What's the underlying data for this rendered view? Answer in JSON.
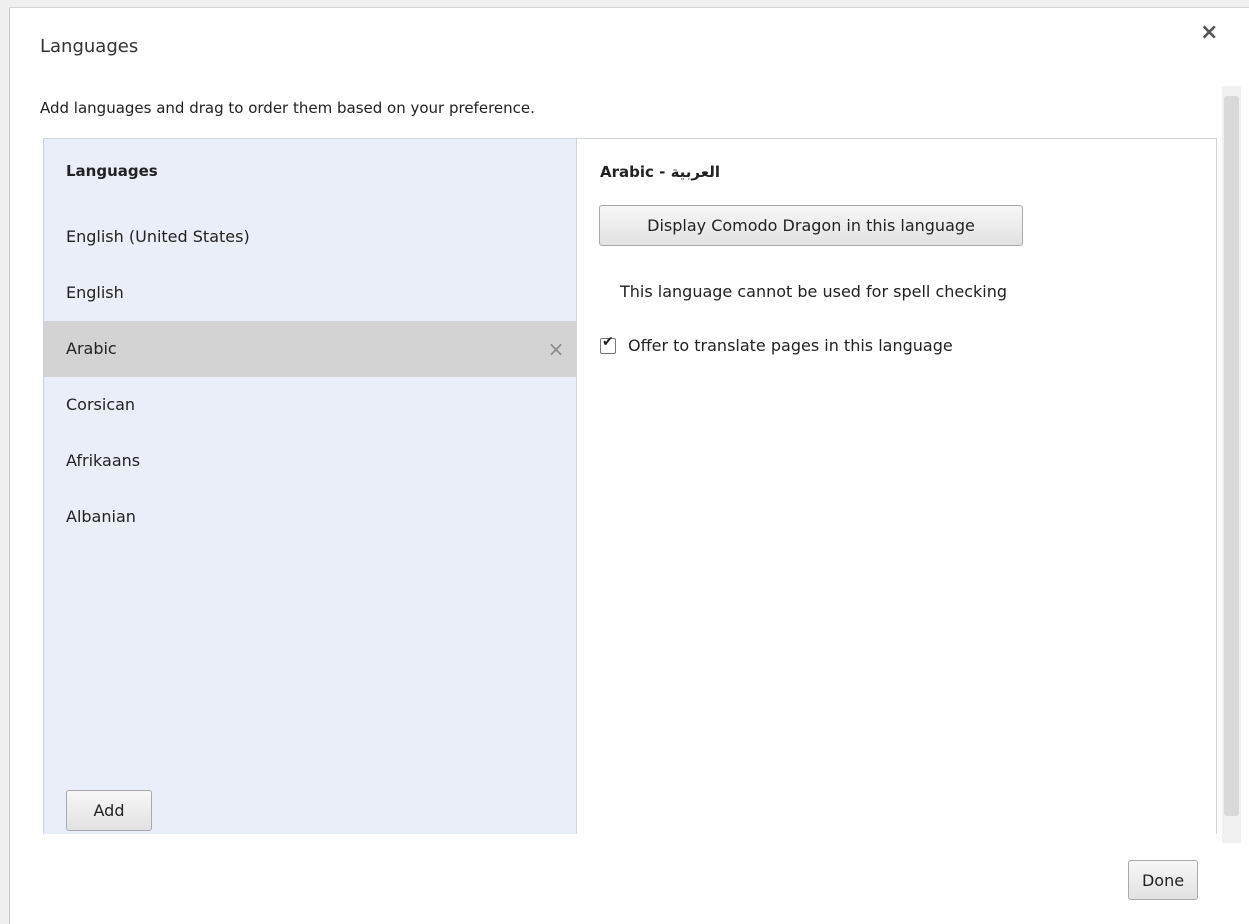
{
  "dialog": {
    "title": "Languages",
    "close_glyph": "×",
    "instructions": "Add languages and drag to order them based on your preference."
  },
  "left_panel": {
    "header": "Languages",
    "items": [
      {
        "label": "English (United States)"
      },
      {
        "label": "English"
      },
      {
        "label": "Arabic",
        "selected": true
      },
      {
        "label": "Corsican"
      },
      {
        "label": "Afrikaans"
      },
      {
        "label": "Albanian"
      }
    ],
    "remove_glyph": "×",
    "add_label": "Add"
  },
  "right_panel": {
    "title": "Arabic - العربية",
    "display_button_label": "Display Comodo Dragon in this language",
    "spell_note": "This language cannot be used for spell checking",
    "translate_label": "Offer to translate pages in this language",
    "translate_checked": true
  },
  "footer": {
    "done_label": "Done"
  }
}
